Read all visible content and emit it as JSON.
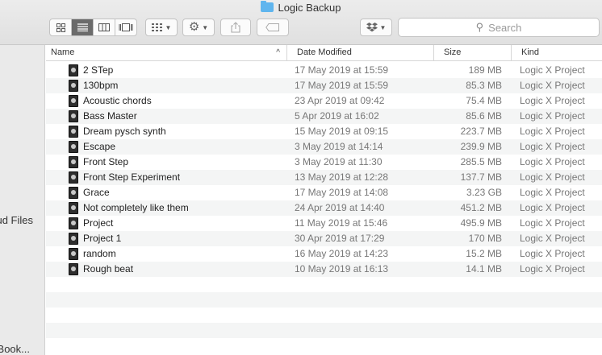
{
  "window": {
    "title": "Logic Backup"
  },
  "toolbar": {
    "search_placeholder": "Search"
  },
  "sidebar": {
    "items": [
      {
        "label": "ud Files"
      },
      {
        "label": "Book..."
      }
    ]
  },
  "columns": {
    "name": "Name",
    "date": "Date Modified",
    "size": "Size",
    "kind": "Kind"
  },
  "files": [
    {
      "name": "2 STep",
      "date": "17 May 2019 at 15:59",
      "size": "189 MB",
      "kind": "Logic X Project"
    },
    {
      "name": "130bpm",
      "date": "17 May 2019 at 15:59",
      "size": "85.3 MB",
      "kind": "Logic X Project"
    },
    {
      "name": "Acoustic chords",
      "date": "23 Apr 2019 at 09:42",
      "size": "75.4 MB",
      "kind": "Logic X Project"
    },
    {
      "name": "Bass Master",
      "date": "5 Apr 2019 at 16:02",
      "size": "85.6 MB",
      "kind": "Logic X Project"
    },
    {
      "name": "Dream pysch synth",
      "date": "15 May 2019 at 09:15",
      "size": "223.7 MB",
      "kind": "Logic X Project"
    },
    {
      "name": "Escape",
      "date": "3 May 2019 at 14:14",
      "size": "239.9 MB",
      "kind": "Logic X Project"
    },
    {
      "name": "Front Step",
      "date": "3 May 2019 at 11:30",
      "size": "285.5 MB",
      "kind": "Logic X Project"
    },
    {
      "name": "Front Step Experiment",
      "date": "13 May 2019 at 12:28",
      "size": "137.7 MB",
      "kind": "Logic X Project"
    },
    {
      "name": "Grace",
      "date": "17 May 2019 at 14:08",
      "size": "3.23 GB",
      "kind": "Logic X Project"
    },
    {
      "name": "Not completely like them",
      "date": "24 Apr 2019 at 14:40",
      "size": "451.2 MB",
      "kind": "Logic X Project"
    },
    {
      "name": "Project",
      "date": "11 May 2019 at 15:46",
      "size": "495.9 MB",
      "kind": "Logic X Project"
    },
    {
      "name": "Project 1",
      "date": "30 Apr 2019 at 17:29",
      "size": "170 MB",
      "kind": "Logic X Project"
    },
    {
      "name": "random",
      "date": "16 May 2019 at 14:23",
      "size": "15.2 MB",
      "kind": "Logic X Project"
    },
    {
      "name": "Rough beat",
      "date": "10 May 2019 at 16:13",
      "size": "14.1 MB",
      "kind": "Logic X Project"
    }
  ]
}
